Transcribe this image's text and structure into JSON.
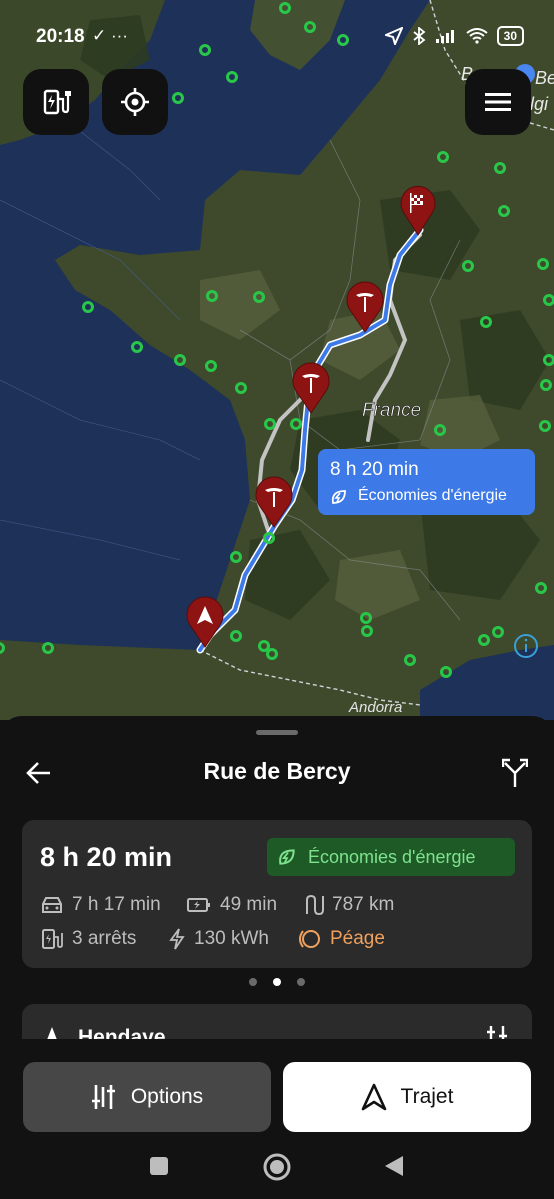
{
  "status_bar": {
    "time": "20:18",
    "icons_left": "✓ ···",
    "battery": "30"
  },
  "map": {
    "country_label": "France",
    "andorra_label": "Andorra",
    "corner_text_1": "B",
    "corner_text_2": "Be",
    "corner_text_3": "lgi",
    "route_label": {
      "duration": "8 h 20 min",
      "subtitle": "Économies d'énergie"
    }
  },
  "top_buttons": {
    "charging_icon": "ev-charger-icon",
    "locate_icon": "crosshair-icon",
    "menu_icon": "hamburger-icon"
  },
  "sheet": {
    "title": "Rue de Bercy",
    "summary": {
      "duration": "8 h 20 min",
      "badge": "Économies d'énergie",
      "drive_time": "7 h 17 min",
      "charge_time": "49 min",
      "distance": "787 km",
      "stops": "3 arrêts",
      "energy": "130 kWh",
      "toll": "Péage"
    },
    "next_waypoint": "Hendaye",
    "options_label": "Options",
    "trajet_label": "Trajet"
  },
  "colors": {
    "route_selected": "#3d7ae8",
    "eco_badge_bg": "#1d5a26",
    "eco_badge_text": "#7ee28e",
    "toll": "#f0a15e",
    "pin": "#8e1414"
  }
}
